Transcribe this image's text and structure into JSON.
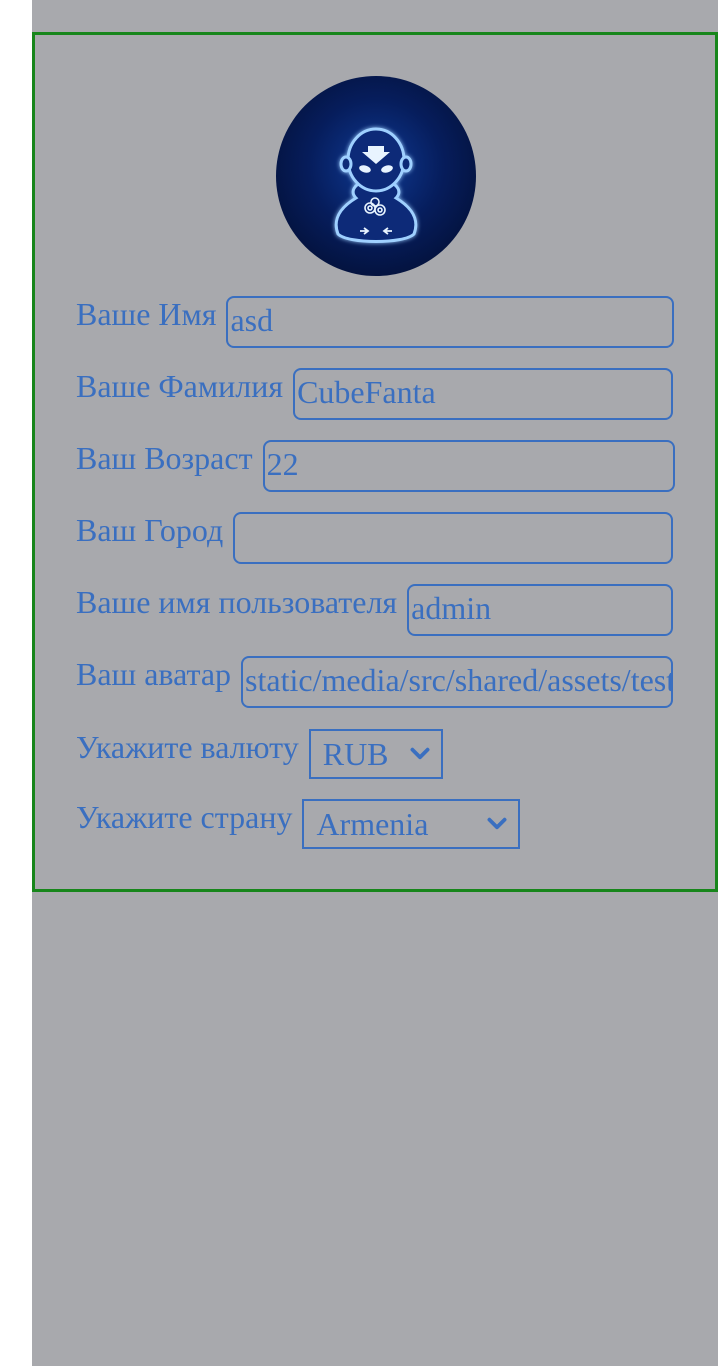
{
  "profile": {
    "fields": [
      {
        "label": "Ваше Имя",
        "value": "asd"
      },
      {
        "label": "Ваше Фамилия",
        "value": "CubeFanta"
      },
      {
        "label": "Ваш Возраст",
        "value": "22"
      },
      {
        "label": "Ваш Город",
        "value": ""
      },
      {
        "label": "Ваше имя пользователя",
        "value": "admin"
      },
      {
        "label": "Ваш аватар",
        "value": "static/media/src/shared/assets/test"
      }
    ],
    "currency": {
      "label": "Укажите валюту",
      "value": "RUB"
    },
    "country": {
      "label": "Укажите страну",
      "value": "Armenia"
    }
  },
  "colors": {
    "accent": "#3a6fc0",
    "card_border": "#17861b",
    "background": "#a8a9ad"
  }
}
